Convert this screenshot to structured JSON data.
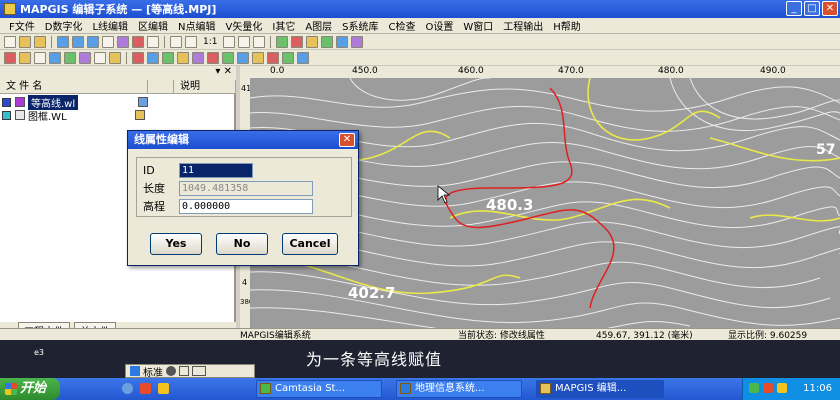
{
  "window": {
    "title": "MAPGIS 编辑子系统 — [等高线.MPJ]"
  },
  "menu": [
    "F文件",
    "D数字化",
    "L线编辑",
    "区编辑",
    "N点编辑",
    "V矢量化",
    "I其它",
    "A图层",
    "S系统库",
    "C检查",
    "O设置",
    "W窗口",
    "工程输出",
    "H帮助"
  ],
  "toolbar": {
    "zoom_label": "1:1"
  },
  "left_panel": {
    "columns": [
      "文 件 名",
      "说明"
    ],
    "files": [
      {
        "name": "等高线.wl",
        "checked": true,
        "selected": true
      },
      {
        "name": "图框.WL",
        "checked": false,
        "selected": false
      }
    ],
    "tabs": [
      "工程文件",
      "单文件"
    ]
  },
  "ruler": {
    "top_ticks": [
      "0.0",
      "450.0",
      "460.0",
      "470.0",
      "480.0",
      "490.0"
    ],
    "left_ticks": [
      "41",
      "5",
      "4",
      "4",
      "4",
      "380"
    ]
  },
  "map": {
    "labels": [
      "480.3",
      "402.7",
      "57"
    ],
    "colors": {
      "background": "#9c9c9c",
      "contour": "#f4f4f4",
      "index_contour": "#e9e94a",
      "selected": "#e02020"
    }
  },
  "status": {
    "app": "MAPGIS编辑系统",
    "state": "当前状态: 修改线属性",
    "coords": "459.67, 391.12 (毫米)",
    "scale": "显示比例: 9.60259"
  },
  "dialog": {
    "title": "线属性编辑",
    "fields": [
      {
        "label": "ID",
        "value": "11"
      },
      {
        "label": "长度",
        "value": "1049.481358"
      },
      {
        "label": "高程",
        "value": "0.000000"
      }
    ],
    "buttons": [
      "Yes",
      "No",
      "Cancel"
    ]
  },
  "caption": {
    "text": "为一条等高线赋值",
    "small": "e3"
  },
  "ime": {
    "label": "标准"
  },
  "taskbar": {
    "start": "开始",
    "tasks": [
      "Camtasia St...",
      "地理信息系统...",
      "MAPGIS 编辑..."
    ],
    "clock": "11:06"
  }
}
